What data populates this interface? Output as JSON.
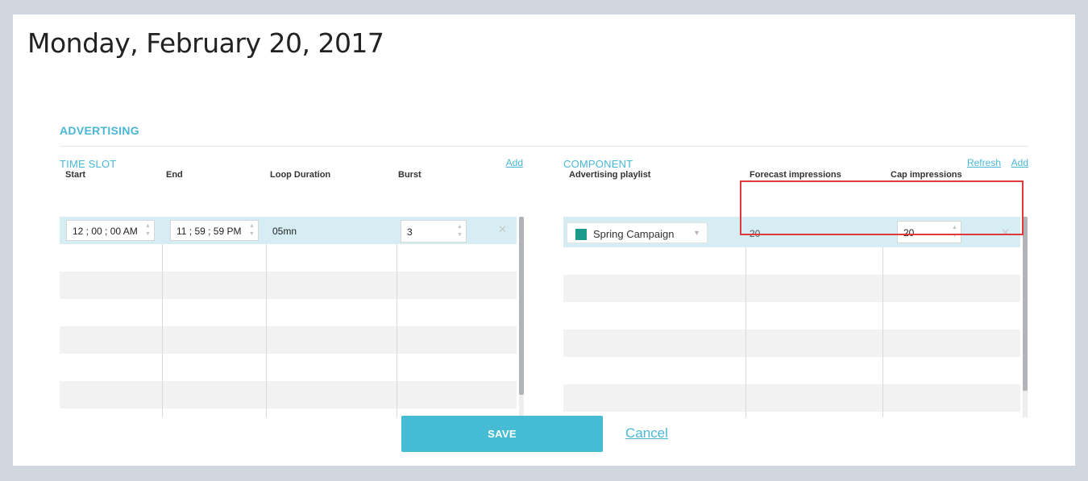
{
  "page_title": "Monday, February 20, 2017",
  "section_title": "ADVERTISING",
  "time_slot": {
    "label": "TIME SLOT",
    "add_link": "Add",
    "columns": [
      "Start",
      "End",
      "Loop Duration",
      "Burst"
    ],
    "rows": [
      {
        "start": "12 ; 00 ; 00 AM",
        "end": "11 ; 59 ; 59 PM",
        "loop_duration": "05mn",
        "burst": "3"
      }
    ]
  },
  "component": {
    "label": "COMPONENT",
    "refresh_link": "Refresh",
    "add_link": "Add",
    "columns": [
      "Advertising playlist",
      "Forecast impressions",
      "Cap impressions"
    ],
    "rows": [
      {
        "playlist": "Spring Campaign",
        "playlist_color": "#1a9a8a",
        "forecast": "20",
        "cap": "20"
      }
    ]
  },
  "icons": {
    "spinner_up": "▲",
    "spinner_down": "▼",
    "remove": "✕",
    "caret": "▼"
  },
  "actions": {
    "save": "SAVE",
    "cancel": "Cancel"
  },
  "colors": {
    "accent": "#45bcd3",
    "highlight": "#e0393b",
    "selected_row": "#d5edf3"
  }
}
